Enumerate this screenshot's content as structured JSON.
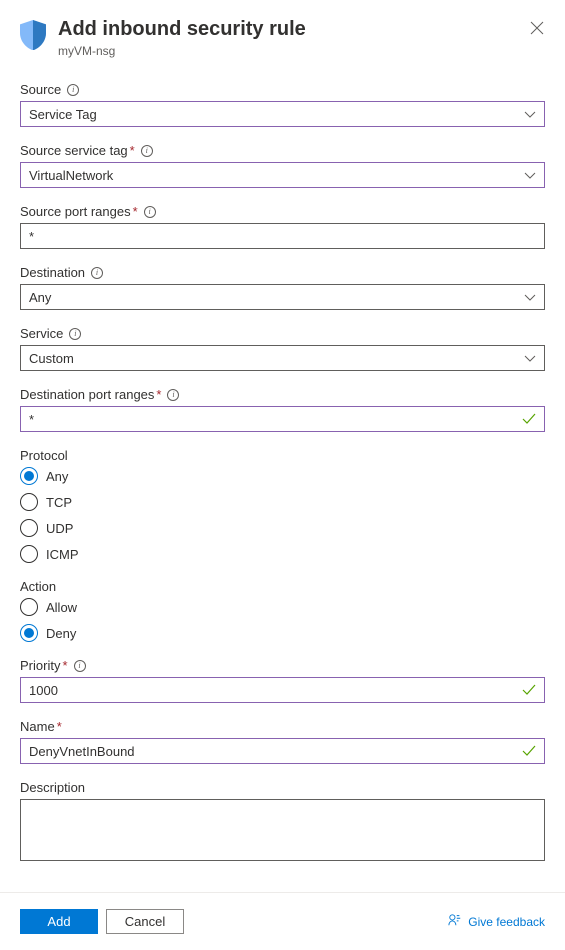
{
  "header": {
    "title": "Add inbound security rule",
    "subtitle": "myVM-nsg"
  },
  "fields": {
    "source": {
      "label": "Source",
      "value": "Service Tag"
    },
    "sourceTag": {
      "label": "Source service tag",
      "value": "VirtualNetwork"
    },
    "sourcePorts": {
      "label": "Source port ranges",
      "value": "*"
    },
    "destination": {
      "label": "Destination",
      "value": "Any"
    },
    "service": {
      "label": "Service",
      "value": "Custom"
    },
    "destPorts": {
      "label": "Destination port ranges",
      "value": "*"
    },
    "protocol": {
      "label": "Protocol",
      "options": [
        "Any",
        "TCP",
        "UDP",
        "ICMP"
      ],
      "selected": "Any"
    },
    "action": {
      "label": "Action",
      "options": [
        "Allow",
        "Deny"
      ],
      "selected": "Deny"
    },
    "priority": {
      "label": "Priority",
      "value": "1000"
    },
    "name": {
      "label": "Name",
      "value": "DenyVnetInBound"
    },
    "description": {
      "label": "Description",
      "value": ""
    }
  },
  "footer": {
    "primary": "Add",
    "secondary": "Cancel",
    "feedback": "Give feedback"
  }
}
